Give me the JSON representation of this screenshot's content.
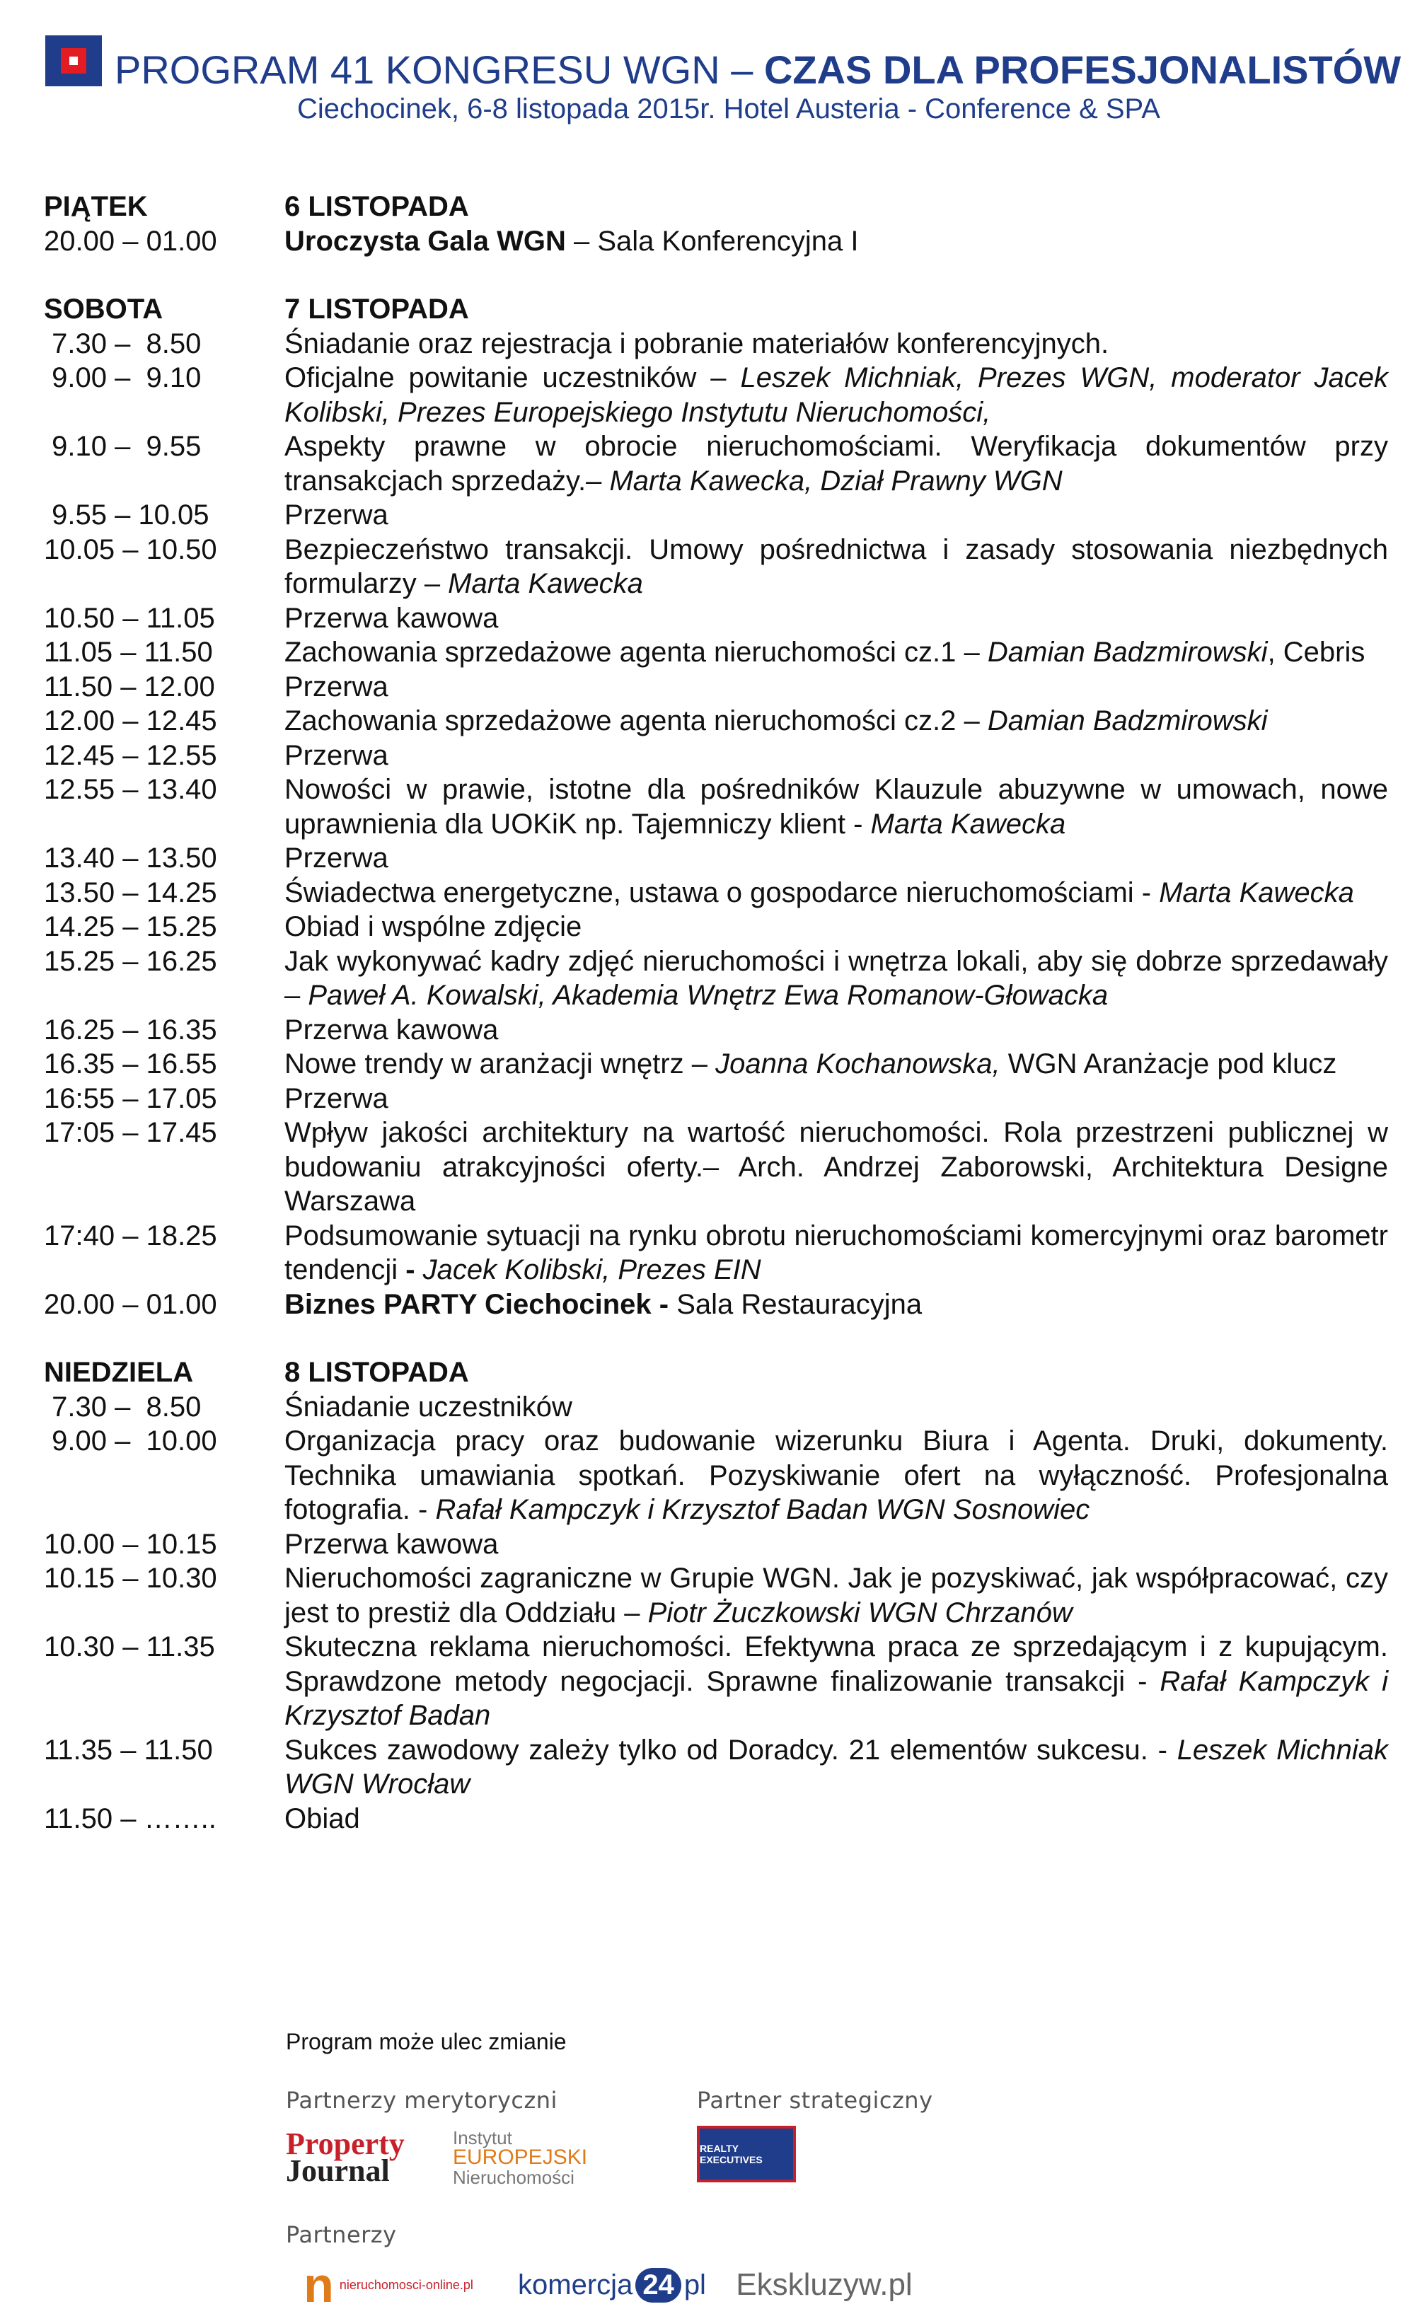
{
  "header": {
    "title_normal": "PROGRAM 41 KONGRESU WGN – ",
    "title_bold": "CZAS DLA PROFESJONALISTÓW",
    "subtitle": "Ciechocinek, 6-8 listopada 2015r. Hotel Austeria - Conference & SPA"
  },
  "days": {
    "fri": {
      "day": "PIĄTEK",
      "date": "6 LISTOPADA",
      "t1": "20.00 – 01.00",
      "e1_bold": "Uroczysta Gala WGN",
      "e1_rest": " – Sala Konferencyjna I"
    },
    "sat": {
      "day": "SOBOTA",
      "date": "7 LISTOPADA",
      "items": [
        {
          "time": " 7.30 –  8.50",
          "text": "Śniadanie oraz rejestracja i pobranie materiałów konferencyjnych."
        },
        {
          "time": " 9.00 –  9.10",
          "text": "Oficjalne powitanie uczestników – ",
          "italic": "Leszek Michniak, Prezes WGN, moderator Jacek Kolibski, Prezes Europejskiego Instytutu Nieruchomości,"
        },
        {
          "time": " 9.10 –  9.55",
          "text": "Aspekty prawne w obrocie nieruchomościami. Weryfikacja dokumentów przy transakcjach sprzedaży.",
          "italic": "– Marta Kawecka, Dział Prawny WGN"
        },
        {
          "time": " 9.55 – 10.05",
          "text": "Przerwa"
        },
        {
          "time": "10.05 – 10.50",
          "text": "Bezpieczeństwo transakcji. Umowy pośrednictwa i zasady stosowania niezbędnych formularzy – ",
          "italic": "Marta Kawecka"
        },
        {
          "time": "10.50 – 11.05",
          "text": "Przerwa kawowa"
        },
        {
          "time": "11.05 – 11.50",
          "text": "Zachowania sprzedażowe agenta nieruchomości cz.1 – ",
          "italic": "Damian Badzmirowski",
          "after": ", Cebris"
        },
        {
          "time": "11.50 – 12.00",
          "text": "Przerwa"
        },
        {
          "time": "12.00 – 12.45",
          "text": "Zachowania sprzedażowe agenta nieruchomości cz.2 – ",
          "italic": "Damian Badzmirowski"
        },
        {
          "time": "12.45 – 12.55",
          "text": "Przerwa"
        },
        {
          "time": "12.55 – 13.40",
          "text": "Nowości w prawie, istotne dla pośredników Klauzule abuzywne w umowach, nowe uprawnienia dla UOKiK np. Tajemniczy klient - ",
          "italic": "Marta Kawecka"
        },
        {
          "time": "13.40 – 13.50",
          "text": "Przerwa"
        },
        {
          "time": "13.50 – 14.25",
          "text": "Świadectwa energetyczne, ustawa o gospodarce nieruchomościami - ",
          "italic": "Marta Kawecka"
        },
        {
          "time": "14.25 – 15.25",
          "text": "Obiad i wspólne zdjęcie"
        },
        {
          "time": "15.25 – 16.25",
          "text": "Jak wykonywać kadry zdjęć nieruchomości i wnętrza lokali, aby się dobrze sprzedawały – ",
          "italic": "Paweł A. Kowalski, Akademia Wnętrz Ewa Romanow-Głowacka"
        },
        {
          "time": "16.25 – 16.35",
          "text": "Przerwa kawowa"
        },
        {
          "time": "16.35 – 16.55",
          "text": "Nowe trendy w aranżacji wnętrz – ",
          "italic": "Joanna Kochanowska,",
          "after": " WGN Aranżacje pod klucz"
        },
        {
          "time": "16:55 – 17.05",
          "text": "Przerwa"
        },
        {
          "time": "17:05 – 17.45",
          "text": "Wpływ jakości architektury na wartość nieruchomości. Rola przestrzeni publicznej w budowaniu atrakcyjności oferty.– Arch. Andrzej Zaborowski, Architektura Designe Warszawa"
        },
        {
          "time": "17:40 – 18.25",
          "text": "Podsumowanie sytuacji na rynku obrotu nieruchomościami komercyjnymi oraz barometr tendencji ",
          "bold": "- ",
          "italic": "Jacek Kolibski, Prezes EIN"
        }
      ],
      "party_time": "20.00 – 01.00",
      "party_bold": "Biznes PARTY Ciechocinek - ",
      "party_rest": "Sala Restauracyjna"
    },
    "sun": {
      "day": "NIEDZIELA",
      "date": "8 LISTOPADA",
      "items": [
        {
          "time": " 7.30 –  8.50",
          "text": "Śniadanie uczestników"
        },
        {
          "time": " 9.00 –  10.00",
          "text": "Organizacja pracy oraz budowanie wizerunku Biura i Agenta. Druki, dokumenty. Technika umawiania spotkań. Pozyskiwanie ofert na wyłączność. Profesjonalna fotografia. - ",
          "italic": "Rafał Kampczyk i Krzysztof Badan WGN Sosnowiec"
        },
        {
          "time": "10.00 – 10.15",
          "text": "Przerwa kawowa"
        },
        {
          "time": "10.15 – 10.30",
          "text": "Nieruchomości zagraniczne w Grupie WGN. Jak je pozyskiwać, jak współpracować, czy jest to prestiż dla Oddziału – ",
          "italic": "Piotr Żuczkowski WGN Chrzanów"
        },
        {
          "time": "10.30 – 11.35",
          "text": "Skuteczna reklama nieruchomości. Efektywna praca ze sprzedającym i z kupującym. Sprawdzone metody negocjacji. Sprawne finalizowanie transakcji - ",
          "italic": "Rafał Kampczyk i Krzysztof Badan"
        },
        {
          "time": "11.35 – 11.50",
          "text": "Sukces zawodowy zależy tylko od Doradcy. 21 elementów sukcesu. - ",
          "italic": "Leszek Michniak WGN Wrocław"
        },
        {
          "time": "11.50 – ……..",
          "text": "Obiad"
        }
      ]
    }
  },
  "footer": {
    "note": "Program może ulec zmianie",
    "partners_merit": "Partnerzy merytoryczni",
    "partner_strategic": "Partner strategiczny",
    "partners": "Partnerzy",
    "logo_pj_1": "Property",
    "logo_pj_2": "Journal",
    "logo_iein_1": "Instytut",
    "logo_iein_2": "EUROPEJSKI",
    "logo_iein_3": "Nieruchomości",
    "logo_rx": "REALTY EXECUTIVES",
    "logo_nom_n": "n",
    "logo_nom_text": "nieruchomosci-online.pl",
    "logo_kom_1": "komercja",
    "logo_kom_2": "24",
    "logo_kom_3": "pl",
    "logo_eks": "Ekskluzyw.pl",
    "accent": "#1f3d8a",
    "brand_red": "#e31b23"
  }
}
